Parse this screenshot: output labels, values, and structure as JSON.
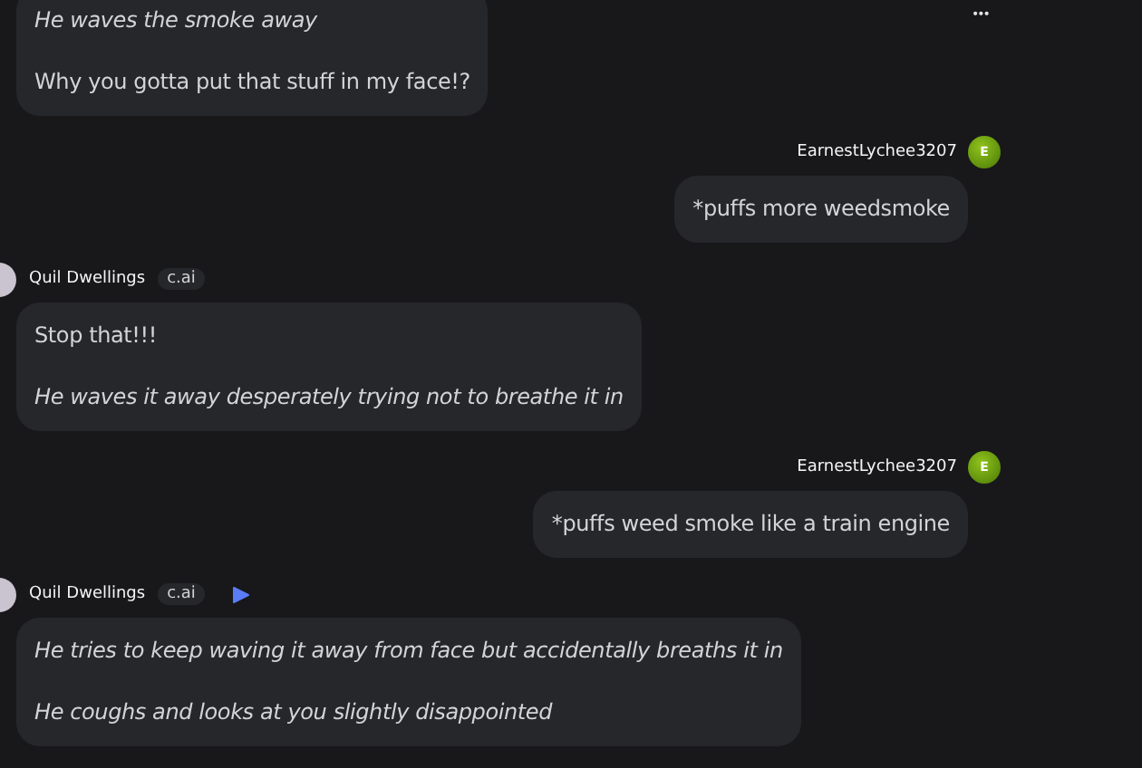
{
  "menu": {
    "label": "•••"
  },
  "messages": [
    {
      "kind": "bot",
      "paragraphs": [
        {
          "text": "He waves the smoke away",
          "italic": true
        },
        {
          "text": "Why you gotta put that stuff in my face!?",
          "italic": false
        }
      ]
    },
    {
      "kind": "user",
      "author": "EarnestLychee3207",
      "avatar_letter": "E",
      "paragraphs": [
        {
          "text": "*puffs more weedsmoke",
          "italic": false
        }
      ]
    },
    {
      "kind": "bot",
      "author": "Quil Dwellings",
      "badge": "c.ai",
      "play": false,
      "paragraphs": [
        {
          "text": "Stop that!!!",
          "italic": false
        },
        {
          "text": "He waves it away desperately trying not to breathe it in",
          "italic": true
        }
      ]
    },
    {
      "kind": "user",
      "author": "EarnestLychee3207",
      "avatar_letter": "E",
      "paragraphs": [
        {
          "text": "*puffs weed smoke like a train engine",
          "italic": false
        }
      ]
    },
    {
      "kind": "bot",
      "author": "Quil Dwellings",
      "badge": "c.ai",
      "play": true,
      "paragraphs": [
        {
          "text": "He tries to keep waving it away from face but accidentally breaths it in",
          "italic": true
        },
        {
          "text": "He coughs and looks at you slightly disappointed",
          "italic": true
        }
      ]
    }
  ]
}
